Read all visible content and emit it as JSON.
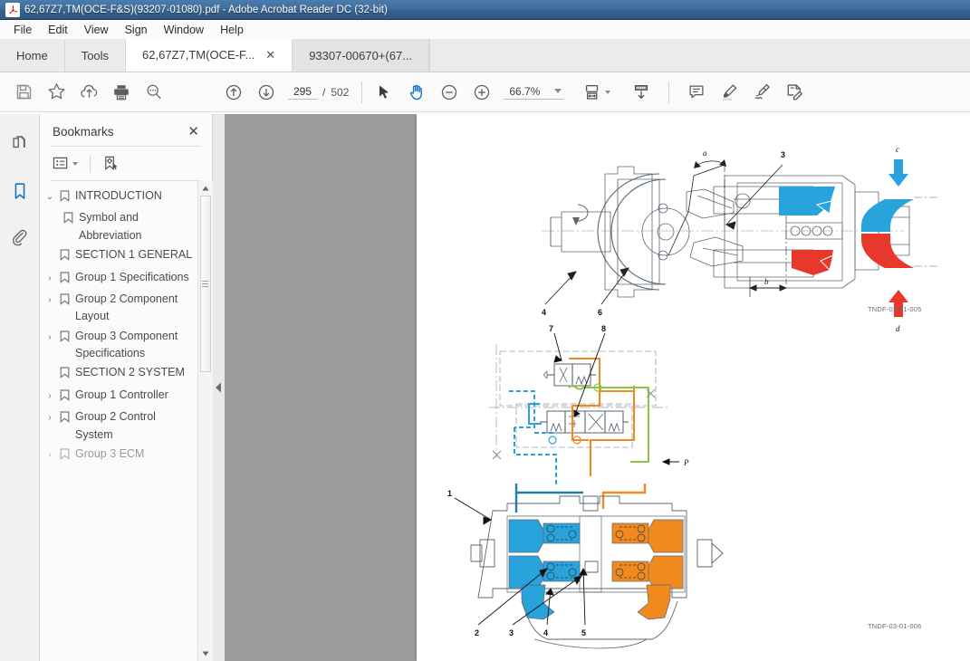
{
  "window": {
    "title": "62,67Z7,TM(OCE-F&S)(93207-01080).pdf - Adobe Acrobat Reader DC (32-bit)",
    "app_icon": "A"
  },
  "menubar": {
    "items": [
      "File",
      "Edit",
      "View",
      "Sign",
      "Window",
      "Help"
    ]
  },
  "tabs": [
    {
      "label": "Home",
      "type": "plain",
      "closable": false
    },
    {
      "label": "Tools",
      "type": "plain",
      "closable": false
    },
    {
      "label": "62,67Z7,TM(OCE-F...",
      "type": "active",
      "closable": true,
      "close_glyph": "✕"
    },
    {
      "label": "93307-00670+(67...",
      "type": "doc",
      "closable": false
    }
  ],
  "toolbar": {
    "left_icons": [
      "save-icon",
      "star-icon",
      "cloud-upload-icon",
      "print-icon",
      "search-icon"
    ],
    "page_prev_icon": "arrow-up-circle-icon",
    "page_next_icon": "arrow-down-circle-icon",
    "page_current": "295",
    "page_separator": "/",
    "page_total": "502",
    "select_tool_icon": "cursor-arrow-icon",
    "hand_tool_icon": "hand-icon",
    "zoom_out_icon": "minus-circle-icon",
    "zoom_in_icon": "plus-circle-icon",
    "zoom_value": "66.7%",
    "fit_icon": "fit-page-icon",
    "scroll_mode_icon": "scroll-down-icon",
    "right_icons": [
      "comment-icon",
      "highlight-icon",
      "sign-icon",
      "fill-and-sign-icon"
    ]
  },
  "rail": {
    "items": [
      {
        "name": "page-thumbnails-icon",
        "active": false
      },
      {
        "name": "bookmarks-icon",
        "active": true
      },
      {
        "name": "attachments-icon",
        "active": false
      }
    ]
  },
  "bookmarks_panel": {
    "title": "Bookmarks",
    "close_glyph": "✕",
    "options_icon": "list-options-icon",
    "new_bookmark_icon": "new-bookmark-icon",
    "items": [
      {
        "label": "INTRODUCTION",
        "level": 1,
        "twisty": "⌄",
        "expanded": true
      },
      {
        "label": "Symbol and Abbreviation",
        "level": 2,
        "twisty": "",
        "expanded": false
      },
      {
        "label": "SECTION 1 GENERAL",
        "level": 1,
        "twisty": "",
        "expanded": false
      },
      {
        "label": "Group 1 Specifications",
        "level": 1,
        "twisty": "›",
        "expanded": false
      },
      {
        "label": "Group 2 Component Layout",
        "level": 1,
        "twisty": "›",
        "expanded": false
      },
      {
        "label": "Group 3 Component Specifications",
        "level": 1,
        "twisty": "›",
        "expanded": false
      },
      {
        "label": "SECTION 2 SYSTEM",
        "level": 1,
        "twisty": "",
        "expanded": false
      },
      {
        "label": "Group 1 Controller",
        "level": 1,
        "twisty": "›",
        "expanded": false
      },
      {
        "label": "Group 2 Control System",
        "level": 1,
        "twisty": "›",
        "expanded": false
      },
      {
        "label": "Group 3 ECM",
        "level": 1,
        "twisty": "›",
        "expanded": false
      }
    ],
    "scroll_up_glyph": "▲",
    "scroll_down_glyph": "▼"
  },
  "viewer": {
    "collapse_glyph": "◀",
    "page_background": "#ffffff",
    "canvas_background": "#9b9b9b"
  },
  "document": {
    "figures": [
      {
        "code": "TNDF-03-01-005",
        "type": "pump-cutaway",
        "callouts_numeric": [
          "3",
          "4",
          "6"
        ],
        "callouts_alpha": [
          "a",
          "b",
          "c",
          "d"
        ]
      },
      {
        "code": "",
        "type": "hydraulic-circuit",
        "callouts_numeric": [
          "7",
          "8"
        ],
        "callouts_alpha": [
          "P"
        ]
      },
      {
        "code": "TNDF-03-01-006",
        "type": "regulator-cutaway",
        "callouts_numeric": [
          "1",
          "2",
          "3",
          "4",
          "5"
        ],
        "callouts_alpha": []
      }
    ],
    "colors": {
      "blue": "#29a3dc",
      "orange": "#f08a1e",
      "red": "#e8372b",
      "green": "#8cc63f",
      "line": "#5a6672"
    }
  }
}
